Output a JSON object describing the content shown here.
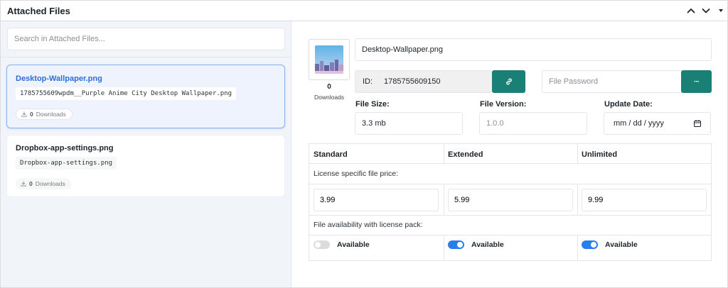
{
  "panel": {
    "title": "Attached Files",
    "collapse_up_icon": "chevron-up-icon",
    "collapse_down_icon": "chevron-down-icon"
  },
  "sidebar": {
    "search_placeholder": "Search in Attached Files...",
    "files": [
      {
        "title": "Desktop-Wallpaper.png",
        "path": "1785755609wpdm__Purple Anime City Desktop Wallpaper.png",
        "downloads_count": "0",
        "downloads_label": "Downloads",
        "active": true
      },
      {
        "title": "Dropbox-app-settings.png",
        "path": "Dropbox-app-settings.png",
        "downloads_count": "0",
        "downloads_label": "Downloads",
        "active": false
      }
    ]
  },
  "detail": {
    "downloads_count": "0",
    "downloads_label": "Downloads",
    "file_name": "Desktop-Wallpaper.png",
    "id_label": "ID:",
    "id_value": "1785755609150",
    "password_placeholder": "File Password",
    "password_button_label": "···",
    "file_size_label": "File Size:",
    "file_size_value": "3.3 mb",
    "file_version_label": "File Version:",
    "file_version_placeholder": "1.0.0",
    "update_date_label": "Update Date:",
    "update_date_placeholder": "mm / dd / yyyy",
    "license": {
      "columns": [
        "Standard",
        "Extended",
        "Unlimited"
      ],
      "price_note": "License specific file price:",
      "prices": [
        "3.99",
        "5.99",
        "9.99"
      ],
      "availability_note": "File availability with license pack:",
      "availability": [
        {
          "label": "Available",
          "enabled": false
        },
        {
          "label": "Available",
          "enabled": true
        },
        {
          "label": "Available",
          "enabled": true
        }
      ]
    }
  },
  "colors": {
    "accent_teal": "#1a8075",
    "active_blue": "#2b6fd6",
    "toggle_on": "#2b7de9"
  }
}
